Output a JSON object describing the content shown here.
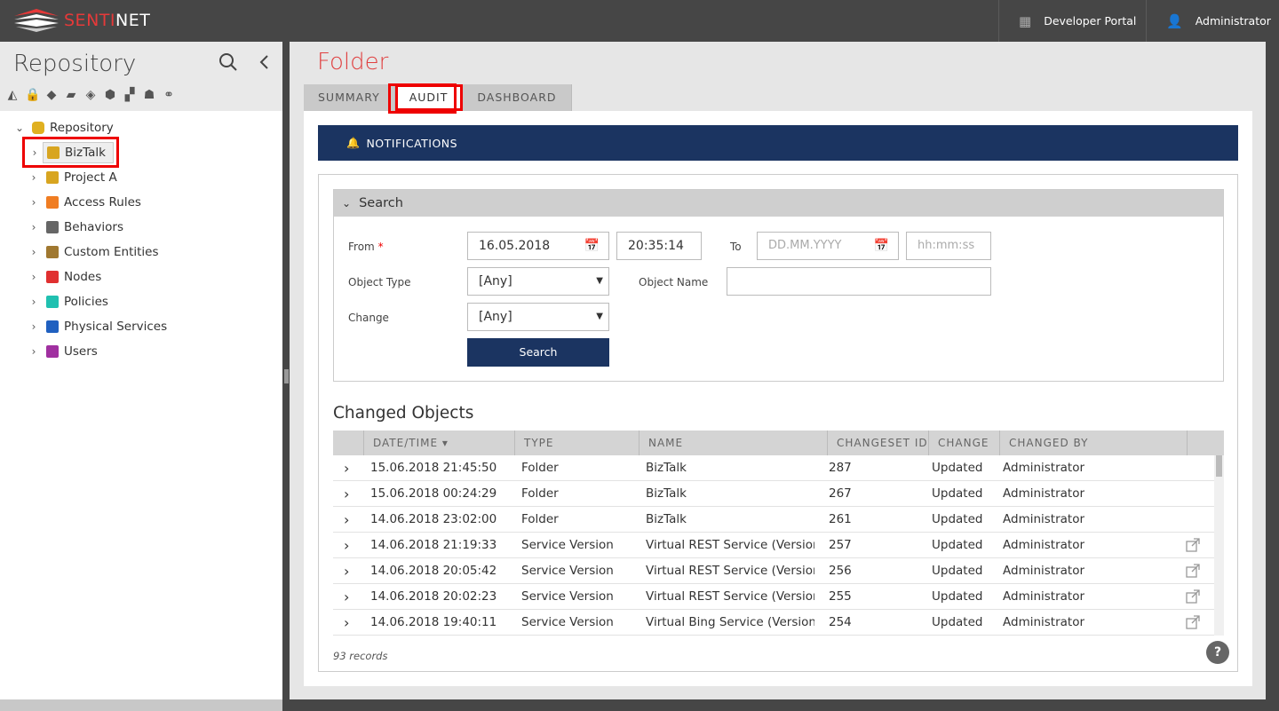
{
  "app": {
    "logo_main": "SENTI",
    "logo_accent": "NET",
    "developer_portal": "Developer Portal",
    "user": "Administrator"
  },
  "left_panel": {
    "title": "Repository",
    "tree_root": "Repository",
    "tree_items": [
      {
        "label": "BizTalk",
        "color": "#d8a520"
      },
      {
        "label": "Project A",
        "color": "#d8a520"
      },
      {
        "label": "Access Rules",
        "color": "#f07d22"
      },
      {
        "label": "Behaviors",
        "color": "#666666"
      },
      {
        "label": "Custom Entities",
        "color": "#a07830"
      },
      {
        "label": "Nodes",
        "color": "#e03030"
      },
      {
        "label": "Policies",
        "color": "#20c0b0"
      },
      {
        "label": "Physical Services",
        "color": "#2060c0"
      },
      {
        "label": "Users",
        "color": "#a030a0"
      }
    ]
  },
  "main": {
    "title": "Folder",
    "tabs": [
      "SUMMARY",
      "AUDIT",
      "DASHBOARD"
    ],
    "notifications": "NOTIFICATIONS",
    "search": {
      "heading": "Search",
      "from_label": "From",
      "from_required": "*",
      "from_date": "16.05.2018",
      "from_time": "20:35:14",
      "to_label": "To",
      "to_date_placeholder": "DD.MM.YYYY",
      "to_time_placeholder": "hh:mm:ss",
      "object_type_label": "Object Type",
      "object_type_value": "[Any]",
      "object_name_label": "Object Name",
      "object_name_value": "",
      "change_label": "Change",
      "change_value": "[Any]",
      "search_button": "Search"
    },
    "changed_objects": {
      "title": "Changed Objects",
      "columns": [
        "DATE/TIME",
        "TYPE",
        "NAME",
        "CHANGESET ID",
        "CHANGE",
        "CHANGED BY"
      ],
      "rows": [
        {
          "datetime": "15.06.2018 21:45:50",
          "type": "Folder",
          "name": "BizTalk",
          "changeset": "287",
          "change": "Updated",
          "by": "Administrator",
          "link": false
        },
        {
          "datetime": "15.06.2018 00:24:29",
          "type": "Folder",
          "name": "BizTalk",
          "changeset": "267",
          "change": "Updated",
          "by": "Administrator",
          "link": false
        },
        {
          "datetime": "14.06.2018 23:02:00",
          "type": "Folder",
          "name": "BizTalk",
          "changeset": "261",
          "change": "Updated",
          "by": "Administrator",
          "link": false
        },
        {
          "datetime": "14.06.2018 21:19:33",
          "type": "Service Version",
          "name": "Virtual REST Service (Version...",
          "changeset": "257",
          "change": "Updated",
          "by": "Administrator",
          "link": true
        },
        {
          "datetime": "14.06.2018 20:05:42",
          "type": "Service Version",
          "name": "Virtual REST Service (Version...",
          "changeset": "256",
          "change": "Updated",
          "by": "Administrator",
          "link": true
        },
        {
          "datetime": "14.06.2018 20:02:23",
          "type": "Service Version",
          "name": "Virtual REST Service (Version...",
          "changeset": "255",
          "change": "Updated",
          "by": "Administrator",
          "link": true
        },
        {
          "datetime": "14.06.2018 19:40:11",
          "type": "Service Version",
          "name": "Virtual Bing Service (Version ...",
          "changeset": "254",
          "change": "Updated",
          "by": "Administrator",
          "link": true
        }
      ],
      "records": "93 records",
      "help": "?"
    }
  }
}
